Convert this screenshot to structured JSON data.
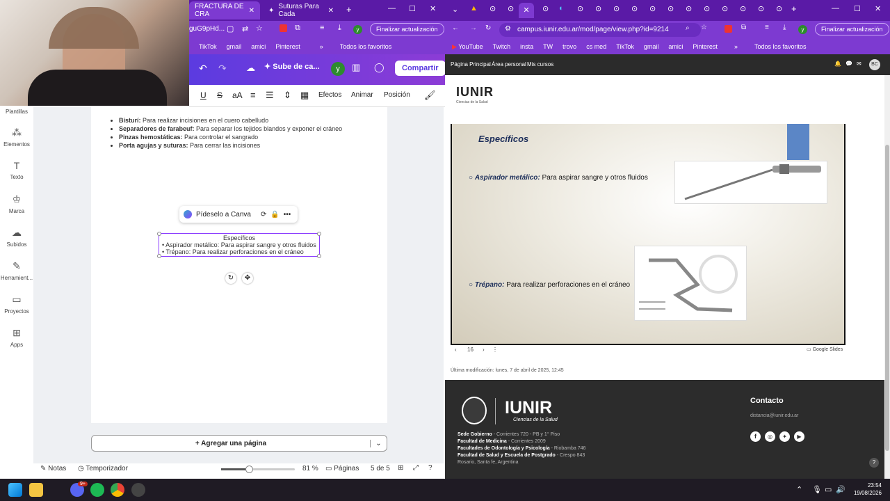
{
  "left_browser": {
    "tabs": [
      {
        "label": "FRACTURA DE CRA"
      },
      {
        "label": "Suturas Para Cada"
      }
    ],
    "url": "guG9pHd...",
    "update_label": "Finalizar actualización",
    "bookmarks": [
      "TikTok",
      "gmail",
      "amici",
      "Pinterest"
    ],
    "favorites_label": "Todos los favoritos"
  },
  "canva": {
    "share_label": "Compartir",
    "upload_label": "Sube de ca...",
    "avatar_letter": "y",
    "format_toolbar": {
      "effects": "Efectos",
      "animate": "Animar",
      "position": "Posición"
    },
    "sidebar": [
      "Plantillas",
      "Elementos",
      "Texto",
      "Marca",
      "Subidos",
      "Herramient...",
      "Proyectos",
      "Apps"
    ],
    "page_list": [
      {
        "term": "Bisturí:",
        "desc": " Para realizar incisiones en el cuero cabelludo"
      },
      {
        "term": "Separadores de farabeuf:",
        "desc": " Para separar los tejidos blandos y exponer el cráneo"
      },
      {
        "term": "Pinzas hemostáticas:",
        "desc": " Para controlar el sangrado"
      },
      {
        "term": "Porta agujas y suturas:",
        "desc": " Para cerrar las incisiones"
      }
    ],
    "ask_label": "Pídeselo a Canva",
    "selected_text": {
      "title": "Específicos",
      "items": [
        "Aspirador metálico: Para aspirar sangre y otros fluidos",
        "Trépano: Para realizar perforaciones en el cráneo"
      ]
    },
    "add_page_label": "+ Agregar una página",
    "bottom": {
      "notes": "Notas",
      "timer": "Temporizador",
      "zoom": "81 %",
      "pages_label": "Páginas",
      "pages_count": "5 de 5",
      "zoom_value": 0.81
    }
  },
  "right_browser": {
    "url": "campus.iunir.edu.ar/mod/page/view.php?id=9214",
    "update_label": "Finalizar actualización",
    "bookmarks": [
      "YouTube",
      "Twitch",
      "insta",
      "TW",
      "trovo",
      "cs med",
      "TikTok",
      "gmail",
      "amici",
      "Pinterest"
    ],
    "favorites_label": "Todos los favoritos",
    "nav": [
      "Página Principal",
      "Área personal",
      "Mis cursos"
    ],
    "user_initials": "BC"
  },
  "slide": {
    "title": "Específicos",
    "items": [
      {
        "term": "Aspirador metálico:",
        "desc": " Para aspirar sangre y otros fluidos"
      },
      {
        "term": "Trépano:",
        "desc": " Para realizar perforaciones en el cráneo"
      }
    ],
    "page_number": "16",
    "provider": "Google Slides"
  },
  "page_meta": {
    "last_modified": "Última modificación: lunes, 7 de abril de 2025, 12:45"
  },
  "footer": {
    "logo": "IUNIR",
    "logo_sub": "Ciencias de la Salud",
    "contact_title": "Contacto",
    "email": "distancia@iunir.edu.ar",
    "addresses": [
      {
        "name": "Sede Gobierno",
        "addr": " - Corrientes 720 - PB y 1° Piso"
      },
      {
        "name": "Facultad de Medicina",
        "addr": " - Corrientes 2009"
      },
      {
        "name": "Facultades de Odontología y Psicología",
        "addr": " - Riobamba 746"
      },
      {
        "name": "Facultad de Salud y Escuela de Postgrado",
        "addr": " - Crespo 843"
      }
    ],
    "city": "Rosario, Santa fe, Argentina"
  },
  "taskbar": {
    "time": "23:54",
    "date": "19/08/2026",
    "badge": "9+"
  },
  "colors": {
    "browser_purple": "#5a1aa6",
    "browser_light": "#7d3ad1",
    "canva_purple": "#8b3dff",
    "footer_bg": "#2c2c2c"
  }
}
